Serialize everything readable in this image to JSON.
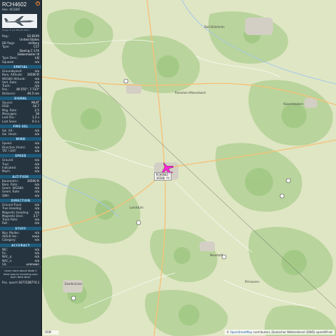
{
  "aircraft": {
    "callsign": "RCH4602",
    "hex_line": "Hex: AE1B0F",
    "photo_credit": "Image © Joe Petroff Other",
    "close_icon": "close-icon"
  },
  "info_rows": [
    {
      "k": "Reg.:",
      "v": "02-8109"
    },
    {
      "k": "",
      "v": "United States"
    },
    {
      "k": "DB flags:",
      "v": "military"
    },
    {
      "k": "Type:",
      "v": "C17"
    },
    {
      "k": "",
      "v": "Boeing C-17A Globemaster III"
    },
    {
      "k": "Type Desc.:",
      "v": "L4J"
    },
    {
      "k": "Squawk:",
      "v": "n/a"
    }
  ],
  "sections": {
    "spatial": "SPATIAL",
    "signal": "SIGNAL",
    "fms": "FMS SEL",
    "wind": "WIND",
    "speed": "SPEED",
    "altitude": "ALTITUDE",
    "direction": "DIRECTION",
    "stuff": "STUFF",
    "accuracy": "ACCURACY"
  },
  "spatial_rows": [
    {
      "k": "Groundspeed:",
      "v": "n/a"
    },
    {
      "k": "Baro. Altitude:",
      "v": "16500 ft"
    },
    {
      "k": "WGS84 Altitude:",
      "v": "n/a"
    },
    {
      "k": "Vert. Rate:",
      "v": "n/a"
    },
    {
      "k": "Track:",
      "v": "n/a"
    },
    {
      "k": "Pos.:",
      "v": "49.555°, 7.733°"
    },
    {
      "k": "Distance:",
      "v": "46.5 nm"
    }
  ],
  "signal_rows": [
    {
      "k": "Source:",
      "v": "MLAT"
    },
    {
      "k": "RSSI:",
      "v": "-16.7"
    },
    {
      "k": "Msg. Rate:",
      "v": "2.5"
    },
    {
      "k": "Messages:",
      "v": "18"
    },
    {
      "k": "Last Pos.:",
      "v": "1.2 s"
    },
    {
      "k": "Last Seen:",
      "v": "0.1 s"
    }
  ],
  "fms_rows": [
    {
      "k": "Sel. Alt.:",
      "v": "n/a"
    },
    {
      "k": "Sel. Head.:",
      "v": "n/a"
    }
  ],
  "wind_rows": [
    {
      "k": "Speed:",
      "v": "n/a"
    },
    {
      "k": "Direction (from):",
      "v": "n/a"
    },
    {
      "k": "TAT / OAT:",
      "v": "n/a"
    }
  ],
  "speed_rows": [
    {
      "k": "Ground:",
      "v": "n/a"
    },
    {
      "k": "True:",
      "v": "n/a"
    },
    {
      "k": "Indicated:",
      "v": "n/a"
    },
    {
      "k": "Mach:",
      "v": "n/a"
    }
  ],
  "altitude_rows": [
    {
      "k": "Barometric:",
      "v": "16500 ft"
    },
    {
      "k": "Baro. Rate:",
      "v": "n/a"
    },
    {
      "k": "Geom. WGS84:",
      "v": "n/a"
    },
    {
      "k": "Geom. Rate:",
      "v": "n/a"
    },
    {
      "k": "QNH:",
      "v": "n/a"
    }
  ],
  "direction_rows": [
    {
      "k": "Ground Track:",
      "v": "n/a"
    },
    {
      "k": "True Heading:",
      "v": "n/a"
    },
    {
      "k": "Magnetic Heading:",
      "v": "n/a"
    },
    {
      "k": "Magnetic Decl.:",
      "v": "3.1°"
    },
    {
      "k": "Track Rate:",
      "v": "n/a"
    },
    {
      "k": "Roll:",
      "v": "n/a"
    }
  ],
  "stuff_rows": [
    {
      "k": "Nav. Modes:",
      "v": "n/a"
    },
    {
      "k": "ADS-B Ver.:",
      "v": "none"
    },
    {
      "k": "Category:",
      "v": "n/a"
    }
  ],
  "accuracy_rows": [
    {
      "k": "NIC:",
      "v": "n/a"
    },
    {
      "k": "Rc:",
      "v": "n/a"
    },
    {
      "k": "NAC_p:",
      "v": "n/a"
    },
    {
      "k": "NAC_v:",
      "v": "n/a"
    },
    {
      "k": "SIL:",
      "v": "unknown"
    }
  ],
  "note": {
    "text": "Learn more about Mode S data type by hovering over each data label.",
    "pos_epoch_label": "Pos. epoch:",
    "pos_epoch_value": "1677228774.1"
  },
  "map": {
    "plane_tag_line1": "RCH4602",
    "plane_tag_line2": "16500 ft",
    "attribution_prefix": "© ",
    "attribution_link": "OpenStreetMap",
    "attribution_rest": " contributors, Deutscher Wetterdienst (DWD) openAIP.net",
    "logo_text": "OSM",
    "plane_color": "#ff2bd6",
    "labels": [
      {
        "text": "Kaiserslautern"
      },
      {
        "text": "Landstuhl"
      },
      {
        "text": "Pirmasens"
      },
      {
        "text": "Ramstein-Miesenbach"
      },
      {
        "text": "Zweibrücken"
      },
      {
        "text": "Bad Dürkheim"
      },
      {
        "text": "Neustadt"
      }
    ]
  }
}
